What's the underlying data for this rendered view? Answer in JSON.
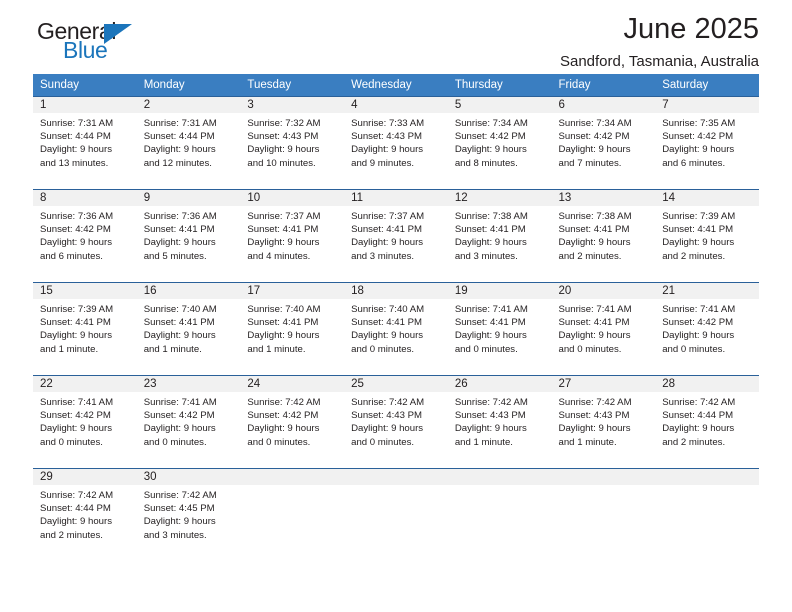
{
  "brand": {
    "name_top": "General",
    "name_bottom": "Blue",
    "accent_color": "#1b75bb",
    "triangle_icon": "blue-triangle-icon"
  },
  "header": {
    "month_title": "June 2025",
    "location": "Sandford, Tasmania, Australia"
  },
  "theme": {
    "header_row_color": "#3a7ec1",
    "row_divider_color": "#2a6099",
    "daynum_band_color": "#f1f1f1",
    "text_color": "#231f20"
  },
  "weekday_headers": [
    "Sunday",
    "Monday",
    "Tuesday",
    "Wednesday",
    "Thursday",
    "Friday",
    "Saturday"
  ],
  "weeks": [
    [
      {
        "day": "1",
        "sunrise": "Sunrise: 7:31 AM",
        "sunset": "Sunset: 4:44 PM",
        "daylight1": "Daylight: 9 hours",
        "daylight2": "and 13 minutes."
      },
      {
        "day": "2",
        "sunrise": "Sunrise: 7:31 AM",
        "sunset": "Sunset: 4:44 PM",
        "daylight1": "Daylight: 9 hours",
        "daylight2": "and 12 minutes."
      },
      {
        "day": "3",
        "sunrise": "Sunrise: 7:32 AM",
        "sunset": "Sunset: 4:43 PM",
        "daylight1": "Daylight: 9 hours",
        "daylight2": "and 10 minutes."
      },
      {
        "day": "4",
        "sunrise": "Sunrise: 7:33 AM",
        "sunset": "Sunset: 4:43 PM",
        "daylight1": "Daylight: 9 hours",
        "daylight2": "and 9 minutes."
      },
      {
        "day": "5",
        "sunrise": "Sunrise: 7:34 AM",
        "sunset": "Sunset: 4:42 PM",
        "daylight1": "Daylight: 9 hours",
        "daylight2": "and 8 minutes."
      },
      {
        "day": "6",
        "sunrise": "Sunrise: 7:34 AM",
        "sunset": "Sunset: 4:42 PM",
        "daylight1": "Daylight: 9 hours",
        "daylight2": "and 7 minutes."
      },
      {
        "day": "7",
        "sunrise": "Sunrise: 7:35 AM",
        "sunset": "Sunset: 4:42 PM",
        "daylight1": "Daylight: 9 hours",
        "daylight2": "and 6 minutes."
      }
    ],
    [
      {
        "day": "8",
        "sunrise": "Sunrise: 7:36 AM",
        "sunset": "Sunset: 4:42 PM",
        "daylight1": "Daylight: 9 hours",
        "daylight2": "and 6 minutes."
      },
      {
        "day": "9",
        "sunrise": "Sunrise: 7:36 AM",
        "sunset": "Sunset: 4:41 PM",
        "daylight1": "Daylight: 9 hours",
        "daylight2": "and 5 minutes."
      },
      {
        "day": "10",
        "sunrise": "Sunrise: 7:37 AM",
        "sunset": "Sunset: 4:41 PM",
        "daylight1": "Daylight: 9 hours",
        "daylight2": "and 4 minutes."
      },
      {
        "day": "11",
        "sunrise": "Sunrise: 7:37 AM",
        "sunset": "Sunset: 4:41 PM",
        "daylight1": "Daylight: 9 hours",
        "daylight2": "and 3 minutes."
      },
      {
        "day": "12",
        "sunrise": "Sunrise: 7:38 AM",
        "sunset": "Sunset: 4:41 PM",
        "daylight1": "Daylight: 9 hours",
        "daylight2": "and 3 minutes."
      },
      {
        "day": "13",
        "sunrise": "Sunrise: 7:38 AM",
        "sunset": "Sunset: 4:41 PM",
        "daylight1": "Daylight: 9 hours",
        "daylight2": "and 2 minutes."
      },
      {
        "day": "14",
        "sunrise": "Sunrise: 7:39 AM",
        "sunset": "Sunset: 4:41 PM",
        "daylight1": "Daylight: 9 hours",
        "daylight2": "and 2 minutes."
      }
    ],
    [
      {
        "day": "15",
        "sunrise": "Sunrise: 7:39 AM",
        "sunset": "Sunset: 4:41 PM",
        "daylight1": "Daylight: 9 hours",
        "daylight2": "and 1 minute."
      },
      {
        "day": "16",
        "sunrise": "Sunrise: 7:40 AM",
        "sunset": "Sunset: 4:41 PM",
        "daylight1": "Daylight: 9 hours",
        "daylight2": "and 1 minute."
      },
      {
        "day": "17",
        "sunrise": "Sunrise: 7:40 AM",
        "sunset": "Sunset: 4:41 PM",
        "daylight1": "Daylight: 9 hours",
        "daylight2": "and 1 minute."
      },
      {
        "day": "18",
        "sunrise": "Sunrise: 7:40 AM",
        "sunset": "Sunset: 4:41 PM",
        "daylight1": "Daylight: 9 hours",
        "daylight2": "and 0 minutes."
      },
      {
        "day": "19",
        "sunrise": "Sunrise: 7:41 AM",
        "sunset": "Sunset: 4:41 PM",
        "daylight1": "Daylight: 9 hours",
        "daylight2": "and 0 minutes."
      },
      {
        "day": "20",
        "sunrise": "Sunrise: 7:41 AM",
        "sunset": "Sunset: 4:41 PM",
        "daylight1": "Daylight: 9 hours",
        "daylight2": "and 0 minutes."
      },
      {
        "day": "21",
        "sunrise": "Sunrise: 7:41 AM",
        "sunset": "Sunset: 4:42 PM",
        "daylight1": "Daylight: 9 hours",
        "daylight2": "and 0 minutes."
      }
    ],
    [
      {
        "day": "22",
        "sunrise": "Sunrise: 7:41 AM",
        "sunset": "Sunset: 4:42 PM",
        "daylight1": "Daylight: 9 hours",
        "daylight2": "and 0 minutes."
      },
      {
        "day": "23",
        "sunrise": "Sunrise: 7:41 AM",
        "sunset": "Sunset: 4:42 PM",
        "daylight1": "Daylight: 9 hours",
        "daylight2": "and 0 minutes."
      },
      {
        "day": "24",
        "sunrise": "Sunrise: 7:42 AM",
        "sunset": "Sunset: 4:42 PM",
        "daylight1": "Daylight: 9 hours",
        "daylight2": "and 0 minutes."
      },
      {
        "day": "25",
        "sunrise": "Sunrise: 7:42 AM",
        "sunset": "Sunset: 4:43 PM",
        "daylight1": "Daylight: 9 hours",
        "daylight2": "and 0 minutes."
      },
      {
        "day": "26",
        "sunrise": "Sunrise: 7:42 AM",
        "sunset": "Sunset: 4:43 PM",
        "daylight1": "Daylight: 9 hours",
        "daylight2": "and 1 minute."
      },
      {
        "day": "27",
        "sunrise": "Sunrise: 7:42 AM",
        "sunset": "Sunset: 4:43 PM",
        "daylight1": "Daylight: 9 hours",
        "daylight2": "and 1 minute."
      },
      {
        "day": "28",
        "sunrise": "Sunrise: 7:42 AM",
        "sunset": "Sunset: 4:44 PM",
        "daylight1": "Daylight: 9 hours",
        "daylight2": "and 2 minutes."
      }
    ],
    [
      {
        "day": "29",
        "sunrise": "Sunrise: 7:42 AM",
        "sunset": "Sunset: 4:44 PM",
        "daylight1": "Daylight: 9 hours",
        "daylight2": "and 2 minutes."
      },
      {
        "day": "30",
        "sunrise": "Sunrise: 7:42 AM",
        "sunset": "Sunset: 4:45 PM",
        "daylight1": "Daylight: 9 hours",
        "daylight2": "and 3 minutes."
      },
      {
        "day": "",
        "sunrise": "",
        "sunset": "",
        "daylight1": "",
        "daylight2": ""
      },
      {
        "day": "",
        "sunrise": "",
        "sunset": "",
        "daylight1": "",
        "daylight2": ""
      },
      {
        "day": "",
        "sunrise": "",
        "sunset": "",
        "daylight1": "",
        "daylight2": ""
      },
      {
        "day": "",
        "sunrise": "",
        "sunset": "",
        "daylight1": "",
        "daylight2": ""
      },
      {
        "day": "",
        "sunrise": "",
        "sunset": "",
        "daylight1": "",
        "daylight2": ""
      }
    ]
  ]
}
